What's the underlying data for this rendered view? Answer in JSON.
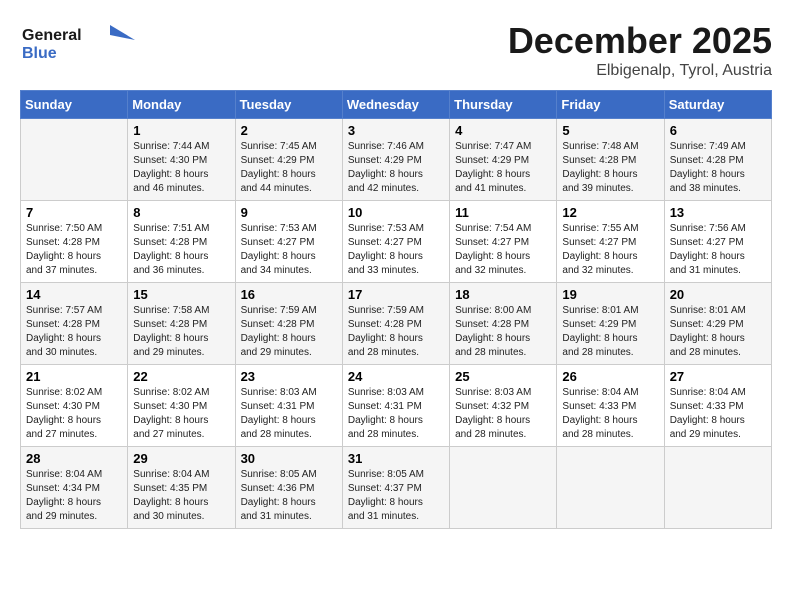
{
  "logo": {
    "line1": "General",
    "line2": "Blue"
  },
  "title": "December 2025",
  "location": "Elbigenalp, Tyrol, Austria",
  "days_of_week": [
    "Sunday",
    "Monday",
    "Tuesday",
    "Wednesday",
    "Thursday",
    "Friday",
    "Saturday"
  ],
  "weeks": [
    [
      {
        "day": "",
        "info": ""
      },
      {
        "day": "1",
        "info": "Sunrise: 7:44 AM\nSunset: 4:30 PM\nDaylight: 8 hours\nand 46 minutes."
      },
      {
        "day": "2",
        "info": "Sunrise: 7:45 AM\nSunset: 4:29 PM\nDaylight: 8 hours\nand 44 minutes."
      },
      {
        "day": "3",
        "info": "Sunrise: 7:46 AM\nSunset: 4:29 PM\nDaylight: 8 hours\nand 42 minutes."
      },
      {
        "day": "4",
        "info": "Sunrise: 7:47 AM\nSunset: 4:29 PM\nDaylight: 8 hours\nand 41 minutes."
      },
      {
        "day": "5",
        "info": "Sunrise: 7:48 AM\nSunset: 4:28 PM\nDaylight: 8 hours\nand 39 minutes."
      },
      {
        "day": "6",
        "info": "Sunrise: 7:49 AM\nSunset: 4:28 PM\nDaylight: 8 hours\nand 38 minutes."
      }
    ],
    [
      {
        "day": "7",
        "info": "Sunrise: 7:50 AM\nSunset: 4:28 PM\nDaylight: 8 hours\nand 37 minutes."
      },
      {
        "day": "8",
        "info": "Sunrise: 7:51 AM\nSunset: 4:28 PM\nDaylight: 8 hours\nand 36 minutes."
      },
      {
        "day": "9",
        "info": "Sunrise: 7:53 AM\nSunset: 4:27 PM\nDaylight: 8 hours\nand 34 minutes."
      },
      {
        "day": "10",
        "info": "Sunrise: 7:53 AM\nSunset: 4:27 PM\nDaylight: 8 hours\nand 33 minutes."
      },
      {
        "day": "11",
        "info": "Sunrise: 7:54 AM\nSunset: 4:27 PM\nDaylight: 8 hours\nand 32 minutes."
      },
      {
        "day": "12",
        "info": "Sunrise: 7:55 AM\nSunset: 4:27 PM\nDaylight: 8 hours\nand 32 minutes."
      },
      {
        "day": "13",
        "info": "Sunrise: 7:56 AM\nSunset: 4:27 PM\nDaylight: 8 hours\nand 31 minutes."
      }
    ],
    [
      {
        "day": "14",
        "info": "Sunrise: 7:57 AM\nSunset: 4:28 PM\nDaylight: 8 hours\nand 30 minutes."
      },
      {
        "day": "15",
        "info": "Sunrise: 7:58 AM\nSunset: 4:28 PM\nDaylight: 8 hours\nand 29 minutes."
      },
      {
        "day": "16",
        "info": "Sunrise: 7:59 AM\nSunset: 4:28 PM\nDaylight: 8 hours\nand 29 minutes."
      },
      {
        "day": "17",
        "info": "Sunrise: 7:59 AM\nSunset: 4:28 PM\nDaylight: 8 hours\nand 28 minutes."
      },
      {
        "day": "18",
        "info": "Sunrise: 8:00 AM\nSunset: 4:28 PM\nDaylight: 8 hours\nand 28 minutes."
      },
      {
        "day": "19",
        "info": "Sunrise: 8:01 AM\nSunset: 4:29 PM\nDaylight: 8 hours\nand 28 minutes."
      },
      {
        "day": "20",
        "info": "Sunrise: 8:01 AM\nSunset: 4:29 PM\nDaylight: 8 hours\nand 28 minutes."
      }
    ],
    [
      {
        "day": "21",
        "info": "Sunrise: 8:02 AM\nSunset: 4:30 PM\nDaylight: 8 hours\nand 27 minutes."
      },
      {
        "day": "22",
        "info": "Sunrise: 8:02 AM\nSunset: 4:30 PM\nDaylight: 8 hours\nand 27 minutes."
      },
      {
        "day": "23",
        "info": "Sunrise: 8:03 AM\nSunset: 4:31 PM\nDaylight: 8 hours\nand 28 minutes."
      },
      {
        "day": "24",
        "info": "Sunrise: 8:03 AM\nSunset: 4:31 PM\nDaylight: 8 hours\nand 28 minutes."
      },
      {
        "day": "25",
        "info": "Sunrise: 8:03 AM\nSunset: 4:32 PM\nDaylight: 8 hours\nand 28 minutes."
      },
      {
        "day": "26",
        "info": "Sunrise: 8:04 AM\nSunset: 4:33 PM\nDaylight: 8 hours\nand 28 minutes."
      },
      {
        "day": "27",
        "info": "Sunrise: 8:04 AM\nSunset: 4:33 PM\nDaylight: 8 hours\nand 29 minutes."
      }
    ],
    [
      {
        "day": "28",
        "info": "Sunrise: 8:04 AM\nSunset: 4:34 PM\nDaylight: 8 hours\nand 29 minutes."
      },
      {
        "day": "29",
        "info": "Sunrise: 8:04 AM\nSunset: 4:35 PM\nDaylight: 8 hours\nand 30 minutes."
      },
      {
        "day": "30",
        "info": "Sunrise: 8:05 AM\nSunset: 4:36 PM\nDaylight: 8 hours\nand 31 minutes."
      },
      {
        "day": "31",
        "info": "Sunrise: 8:05 AM\nSunset: 4:37 PM\nDaylight: 8 hours\nand 31 minutes."
      },
      {
        "day": "",
        "info": ""
      },
      {
        "day": "",
        "info": ""
      },
      {
        "day": "",
        "info": ""
      }
    ]
  ]
}
